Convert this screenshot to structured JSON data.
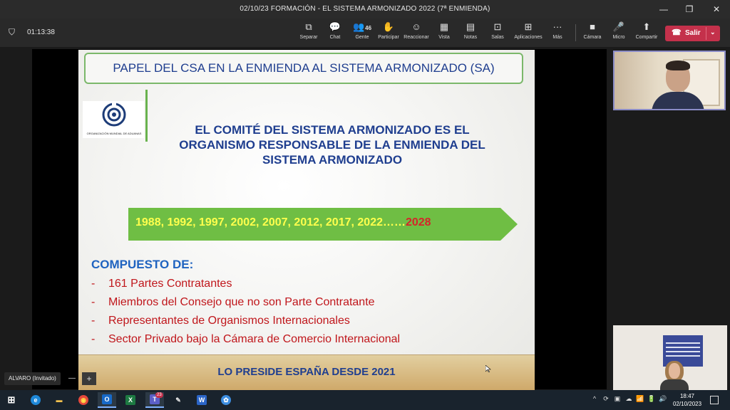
{
  "window": {
    "title": "02/10/23 FORMACIÓN - EL SISTEMA ARMONIZADO 2022 (7ª ENMIENDA)",
    "controls": {
      "minimize": "—",
      "restore": "❐",
      "close": "✕"
    }
  },
  "toolbar": {
    "shield_icon": "shield-icon",
    "timer": "01:13:38",
    "buttons": [
      {
        "label": "Separar",
        "icon": "⧉"
      },
      {
        "label": "Chat",
        "icon": "💬"
      },
      {
        "label": "Gente",
        "icon": "👥",
        "count": "46"
      },
      {
        "label": "Participar",
        "icon": "✋"
      },
      {
        "label": "Reaccionar",
        "icon": "☺"
      },
      {
        "label": "Vista",
        "icon": "▦"
      },
      {
        "label": "Notas",
        "icon": "▤"
      },
      {
        "label": "Salas",
        "icon": "⊡"
      },
      {
        "label": "Aplicaciones",
        "icon": "⊞"
      },
      {
        "label": "Más",
        "icon": "···"
      },
      {
        "label": "Cámara",
        "icon": "■"
      },
      {
        "label": "Micro",
        "icon": "🎤"
      },
      {
        "label": "Compartir",
        "icon": "⬆"
      }
    ],
    "leave": {
      "label": "Salir",
      "color": "#c4314b"
    }
  },
  "slide": {
    "title": "PAPEL DEL CSA EN LA ENMIENDA AL SISTEMA ARMONIZADO (SA)",
    "logo_text": "ORGANIZACIÓN MUNDIAL DE ADUANAS",
    "heading_lines": [
      "EL COMITÉ DEL SISTEMA ARMONIZADO ES EL",
      "ORGANISMO RESPONSABLE DE LA ENMIENDA DEL",
      "SISTEMA ARMONIZADO"
    ],
    "years": "1988, 1992, 1997, 2002, 2007, 2012, 2017, 2022……",
    "years_final": "2028",
    "composed_title": "COMPUESTO DE:",
    "composed_items": [
      {
        "dash": "-",
        "text": "161 Partes Contratantes"
      },
      {
        "dash": "-",
        "text": "Miembros del Consejo que no son Parte Contratante"
      },
      {
        "dash": "-",
        "text": "Representantes de Organismos Internacionales"
      },
      {
        "dash": "-",
        "text": "Sector Privado bajo la Cámara de Comercio Internacional"
      }
    ],
    "footer": "LO PRESIDE ESPAÑA DESDE 2021",
    "colors": {
      "title_blue": "#1f3e8f",
      "list_red": "#c0161b",
      "arrow_green": "#6fbe44",
      "years_yellow": "#ffff4d"
    }
  },
  "presenter": {
    "name": "ALVARO (Invitado)",
    "minimize": "—",
    "add": "+"
  },
  "taskbar": {
    "apps": [
      {
        "name": "start-icon",
        "label": "⊞",
        "color": "#ffffff"
      },
      {
        "name": "edge-icon",
        "label": "e",
        "color": "#1e88d8"
      },
      {
        "name": "explorer-icon",
        "label": "▬",
        "color": "#f2c14e"
      },
      {
        "name": "chrome-icon",
        "label": "◉",
        "color": "#e5483b"
      },
      {
        "name": "outlook-icon",
        "label": "O",
        "color": "#1769c8"
      },
      {
        "name": "excel-icon",
        "label": "X",
        "color": "#1d7a42"
      },
      {
        "name": "teams-icon",
        "label": "T",
        "color": "#5b5fc7",
        "badge": "23"
      },
      {
        "name": "paint-icon",
        "label": "✎",
        "color": "#e9e9e9"
      },
      {
        "name": "word-icon",
        "label": "W",
        "color": "#2b65c7"
      },
      {
        "name": "app-icon",
        "label": "✿",
        "color": "#3c8de0"
      }
    ],
    "tray": [
      "^",
      "⟳",
      "▣",
      "☁",
      "📶",
      "🔋",
      "🔊"
    ],
    "time": "18:47",
    "date": "02/10/2023"
  }
}
